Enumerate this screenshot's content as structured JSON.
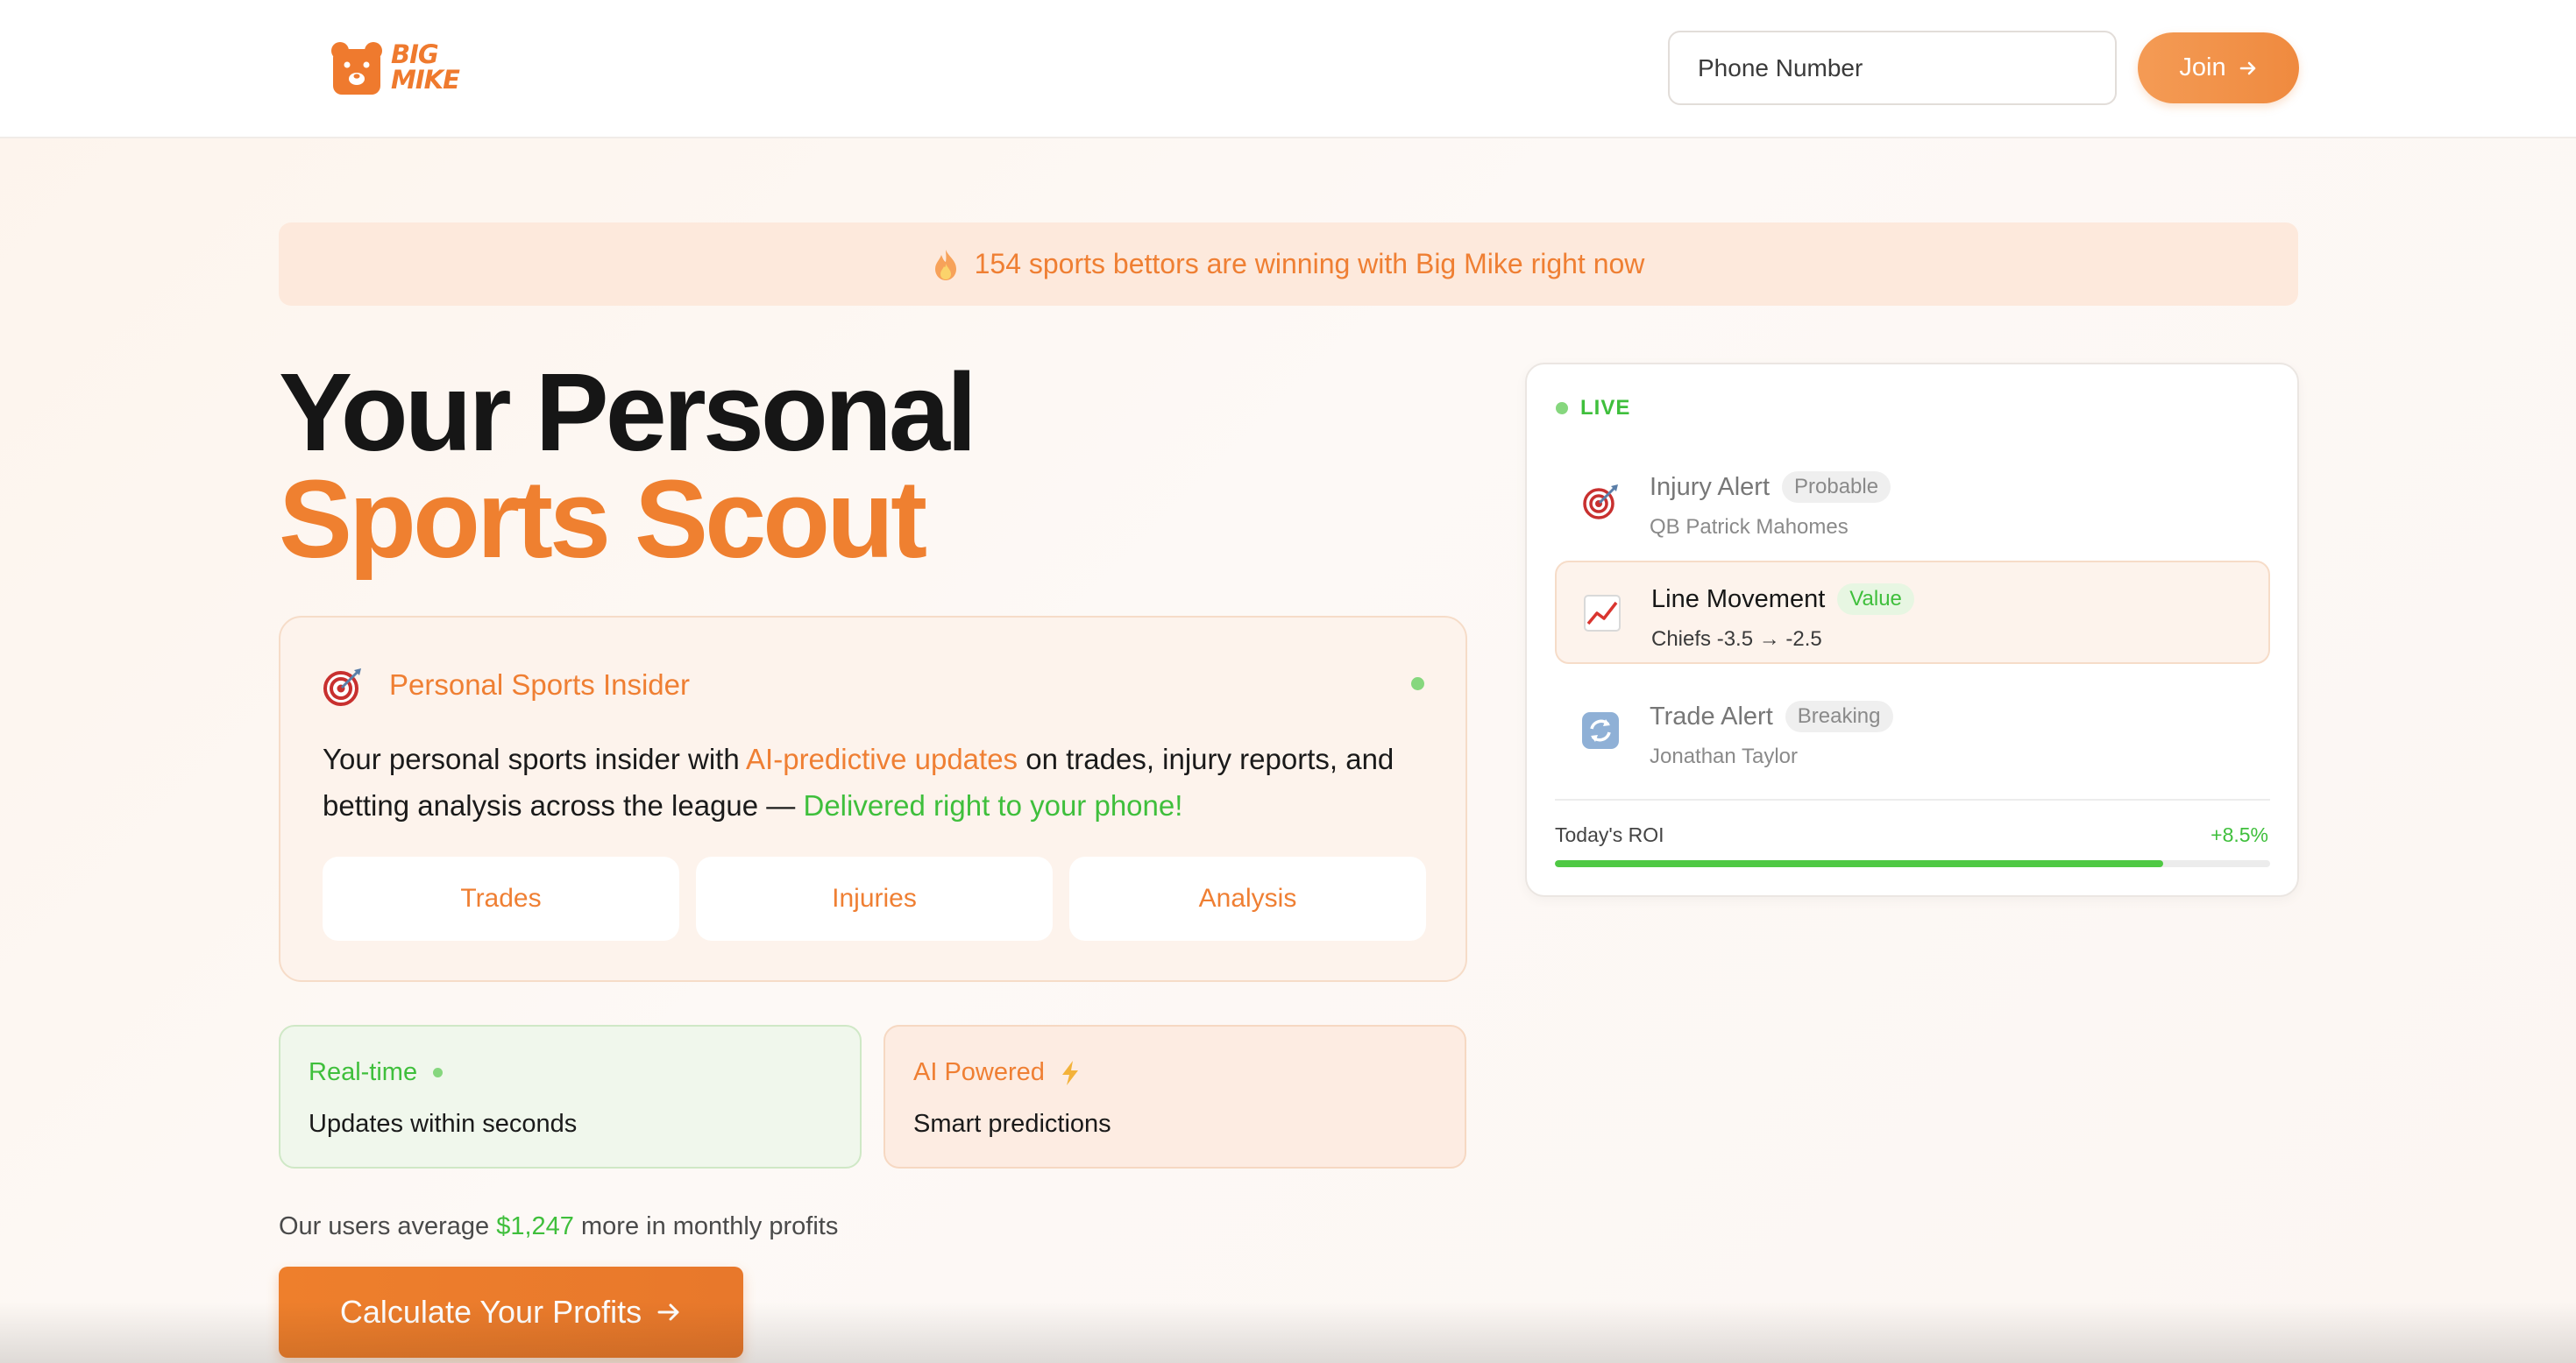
{
  "header": {
    "logo_line1": "BIG",
    "logo_line2": "MIKE",
    "phone_placeholder": "Phone Number",
    "join_label": "Join",
    "join_icon": "arrow-right-icon"
  },
  "banner": {
    "icon": "fire-icon",
    "text": "154 sports bettors are winning with Big Mike right now"
  },
  "hero": {
    "line1": "Your Personal",
    "line2": "Sports Scout"
  },
  "insider": {
    "icon": "target-icon",
    "title": "Personal Sports Insider",
    "desc_part1": "Your personal sports insider with ",
    "desc_highlight1": "AI-predictive updates",
    "desc_part2": " on trades, injury reports, and betting analysis across the league — ",
    "desc_highlight2": "Delivered right to your phone!",
    "pills": [
      "Trades",
      "Injuries",
      "Analysis"
    ]
  },
  "features": [
    {
      "title": "Real-time",
      "text": "Updates within seconds"
    },
    {
      "title": "AI Powered",
      "icon": "lightning-icon",
      "text": "Smart predictions"
    }
  ],
  "profits": {
    "prefix": "Our users average ",
    "amount": "$1,247",
    "suffix": " more in monthly profits",
    "cta_label": "Calculate Your Profits"
  },
  "live_panel": {
    "live_label": "LIVE",
    "alerts": [
      {
        "icon": "target-icon",
        "title": "Injury Alert",
        "badge": "Probable",
        "sub": "QB Patrick Mahomes"
      },
      {
        "icon": "chart-up-icon",
        "title": "Line Movement",
        "badge": "Value",
        "sub": "Chiefs -3.5 → -2.5"
      },
      {
        "icon": "refresh-icon",
        "title": "Trade Alert",
        "badge": "Breaking",
        "sub": "Jonathan Taylor"
      }
    ],
    "roi_label": "Today's ROI",
    "roi_value": "+8.5%",
    "roi_progress_fraction": 0.85
  },
  "colors": {
    "brand_orange": "#ef7f33",
    "success_green": "#3fbf3c"
  }
}
